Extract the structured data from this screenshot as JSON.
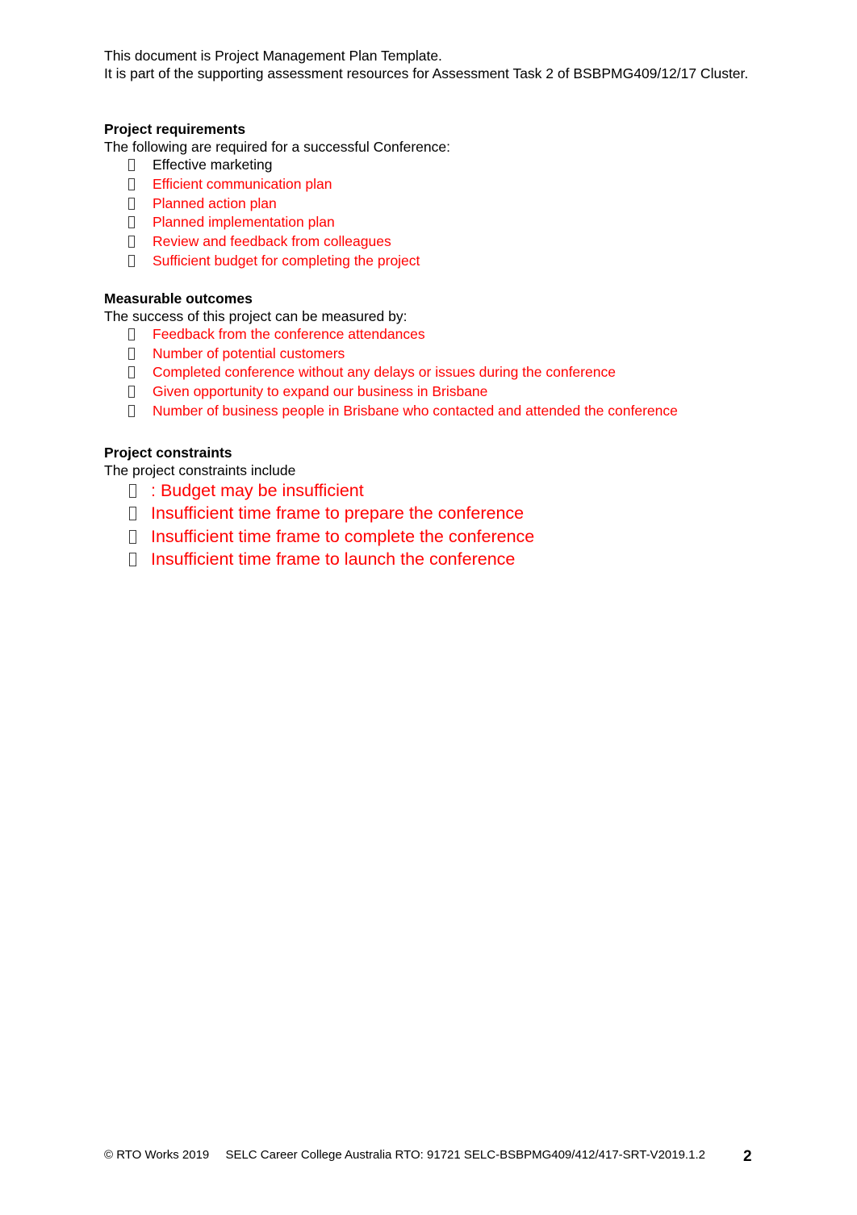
{
  "document": {
    "intro_lines": [
      "This document is Project Management Plan Template.",
      "It is part of the supporting assessment resources for Assessment Task 2 of BSBPMG409/12/17 Cluster."
    ]
  },
  "colors": {
    "answer_text": "#ff0000",
    "body_text": "#000000",
    "page_background": "#ffffff"
  },
  "sections": {
    "requirements": {
      "heading": "Project requirements",
      "lead": "The following are required for a successful Conference:",
      "items": [
        {
          "text": "Effective marketing",
          "color": "black"
        },
        {
          "text": "Efficient communication plan",
          "color": "red"
        },
        {
          "text": "Planned action plan",
          "color": "red"
        },
        {
          "text": "Planned implementation plan",
          "color": "red"
        },
        {
          "text": "Review and feedback from colleagues",
          "color": "red"
        },
        {
          "text": "Sufficient budget for completing the project",
          "color": "red"
        }
      ]
    },
    "outcomes": {
      "heading": "Measurable outcomes",
      "lead": "The success of this project can be measured by:",
      "items": [
        {
          "text": "Feedback from the conference attendances",
          "color": "red"
        },
        {
          "text": "Number of potential customers",
          "color": "red"
        },
        {
          "text": "Completed conference without any delays or issues during the conference",
          "color": "red"
        },
        {
          "text": "Given opportunity to expand our business in Brisbane",
          "color": "red"
        },
        {
          "text": "Number of business people in Brisbane who contacted and attended the conference",
          "color": "red"
        }
      ]
    },
    "constraints": {
      "heading": "Project constraints",
      "lead": "The project constraints include",
      "items": [
        {
          "text": ": Budget may be insufficient",
          "color": "red"
        },
        {
          "text": "Insufficient time frame to prepare the conference",
          "color": "red"
        },
        {
          "text": "Insufficient time frame to complete the conference",
          "color": "red"
        },
        {
          "text": "Insufficient time frame to launch the conference",
          "color": "red"
        }
      ]
    }
  },
  "footer": {
    "copyright": "© RTO Works 2019",
    "institution": "SELC Career College Australia RTO: 91721 SELC-BSBPMG409/412/417-SRT-V2019.1.2",
    "page_number": "2"
  }
}
